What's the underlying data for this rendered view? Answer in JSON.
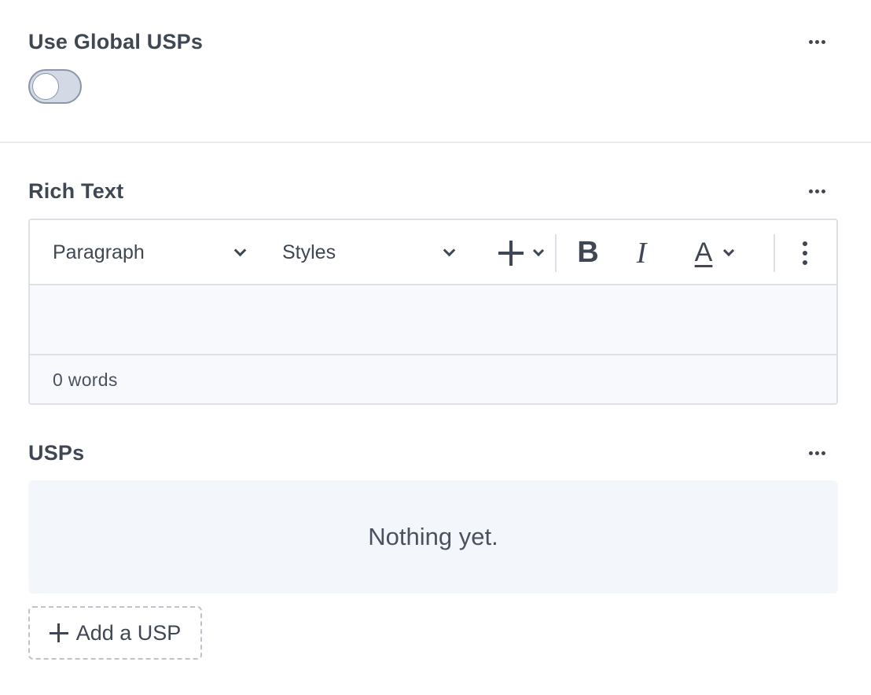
{
  "global_usps": {
    "title": "Use Global USPs",
    "toggle_on": false
  },
  "rich_text": {
    "title": "Rich Text",
    "toolbar": {
      "block_format": "Paragraph",
      "styles": "Styles",
      "bold_glyph": "B",
      "italic_glyph": "I",
      "color_glyph": "A"
    },
    "word_count": "0 words"
  },
  "usps": {
    "title": "USPs",
    "empty_message": "Nothing yet.",
    "add_label": "Add a USP"
  },
  "icons": [
    "more-horizontal-icon",
    "chevron-down-icon",
    "plus-icon",
    "bold-icon",
    "italic-icon",
    "text-color-icon",
    "more-vertical-icon"
  ],
  "colors": {
    "text": "#3f4753",
    "border": "#dde1e7",
    "toggle_track": "#d3dae5",
    "panel_bg": "#f3f6fa"
  }
}
